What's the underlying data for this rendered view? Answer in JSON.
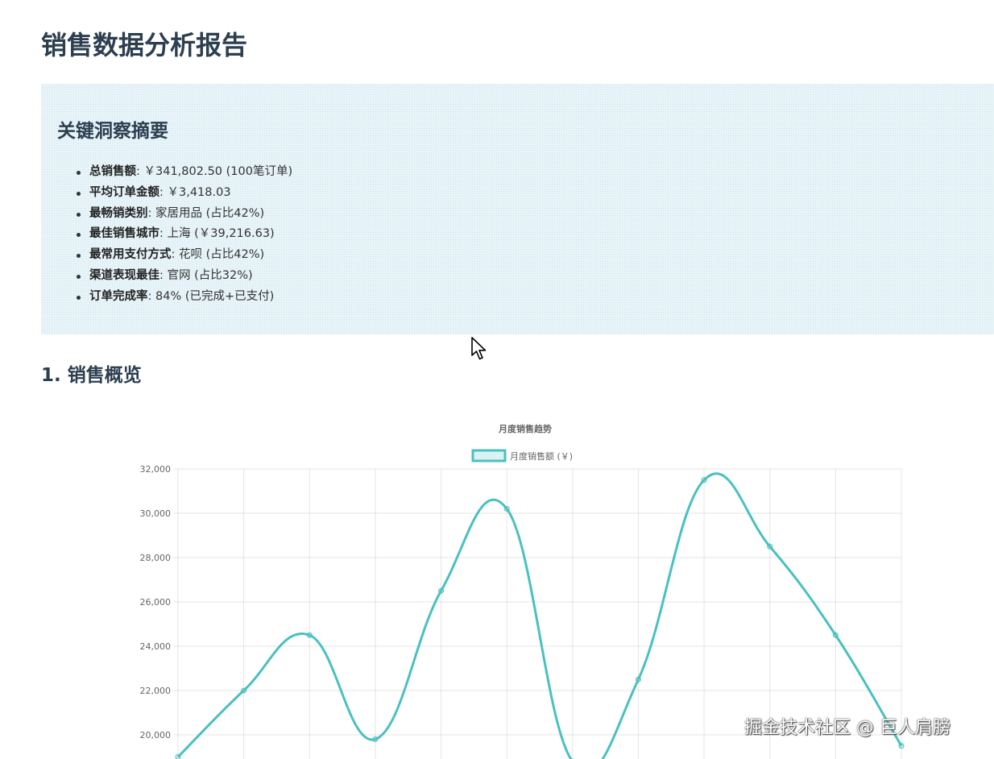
{
  "page": {
    "title": "销售数据分析报告"
  },
  "summary": {
    "title": "关键洞察摘要",
    "items": [
      {
        "label": "总销售额",
        "value": ": ￥341,802.50 (100笔订单)"
      },
      {
        "label": "平均订单金额",
        "value": ": ￥3,418.03"
      },
      {
        "label": "最畅销类别",
        "value": ": 家居用品 (占比42%)"
      },
      {
        "label": "最佳销售城市",
        "value": ": 上海 (￥39,216.63)"
      },
      {
        "label": "最常用支付方式",
        "value": ": 花呗 (占比42%)"
      },
      {
        "label": "渠道表现最佳",
        "value": ": 官网 (占比32%)"
      },
      {
        "label": "订单完成率",
        "value": ": 84% (已完成+已支付)"
      }
    ]
  },
  "section1": {
    "title": "1. 销售概览"
  },
  "chart_data": {
    "type": "line",
    "title": "月度销售趋势",
    "series": [
      {
        "name": "月度销售额 (￥)",
        "color": "#4bc0c0",
        "values": [
          19000,
          22000,
          24500,
          19800,
          26500,
          30200,
          18800,
          22500,
          31500,
          28500,
          24500,
          19500
        ]
      }
    ],
    "ylim": [
      18000,
      32000
    ],
    "yticks": [
      "32,000",
      "30,000",
      "28,000",
      "26,000",
      "24,000",
      "22,000",
      "20,000"
    ],
    "ytick_values": [
      32000,
      30000,
      28000,
      26000,
      24000,
      22000,
      20000
    ],
    "grid": true,
    "legend": "top"
  },
  "watermark": "掘金技术社区 @ 巨人肩膀"
}
